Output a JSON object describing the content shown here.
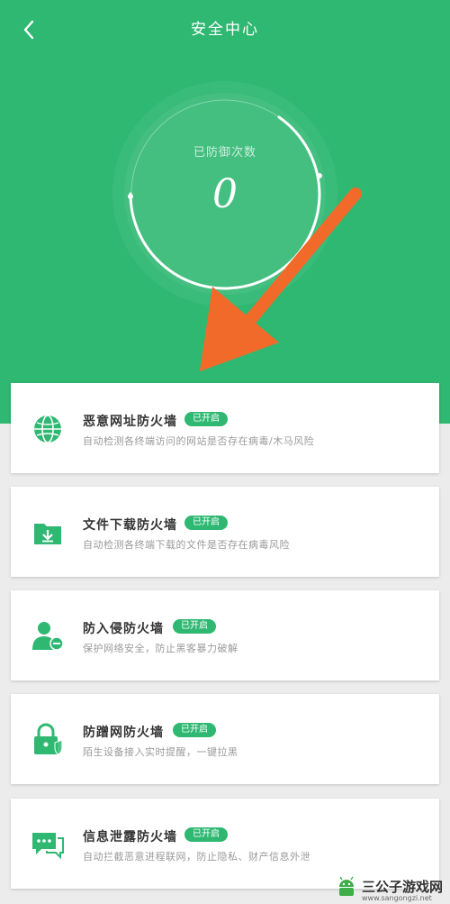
{
  "header": {
    "title": "安全中心",
    "back_icon": "chevron-left-icon"
  },
  "gauge": {
    "label": "已防御次数",
    "value": "0"
  },
  "colors": {
    "brand_green": "#2fb872",
    "annotation_arrow": "#f26a2a"
  },
  "cards": [
    {
      "icon": "globe-icon",
      "name": "恶意网址防火墙",
      "status": "已开启",
      "desc": "自动检测各终端访问的网站是否存在病毒/木马风险"
    },
    {
      "icon": "folder-download-icon",
      "name": "文件下载防火墙",
      "status": "已开启",
      "desc": "自动检测各终端下载的文件是否存在病毒风险"
    },
    {
      "icon": "user-block-icon",
      "name": "防入侵防火墙",
      "status": "已开启",
      "desc": "保护网络安全，防止黑客暴力破解"
    },
    {
      "icon": "lock-shield-icon",
      "name": "防蹭网防火墙",
      "status": "已开启",
      "desc": "陌生设备接入实时提醒，一键拉黑"
    },
    {
      "icon": "chat-bubbles-icon",
      "name": "信息泄露防火墙",
      "status": "已开启",
      "desc": "自动拦截恶意进程联网，防止隐私、财产信息外泄"
    }
  ],
  "watermark": {
    "text": "三公子游戏网",
    "url": "www.sangongzi.net"
  }
}
